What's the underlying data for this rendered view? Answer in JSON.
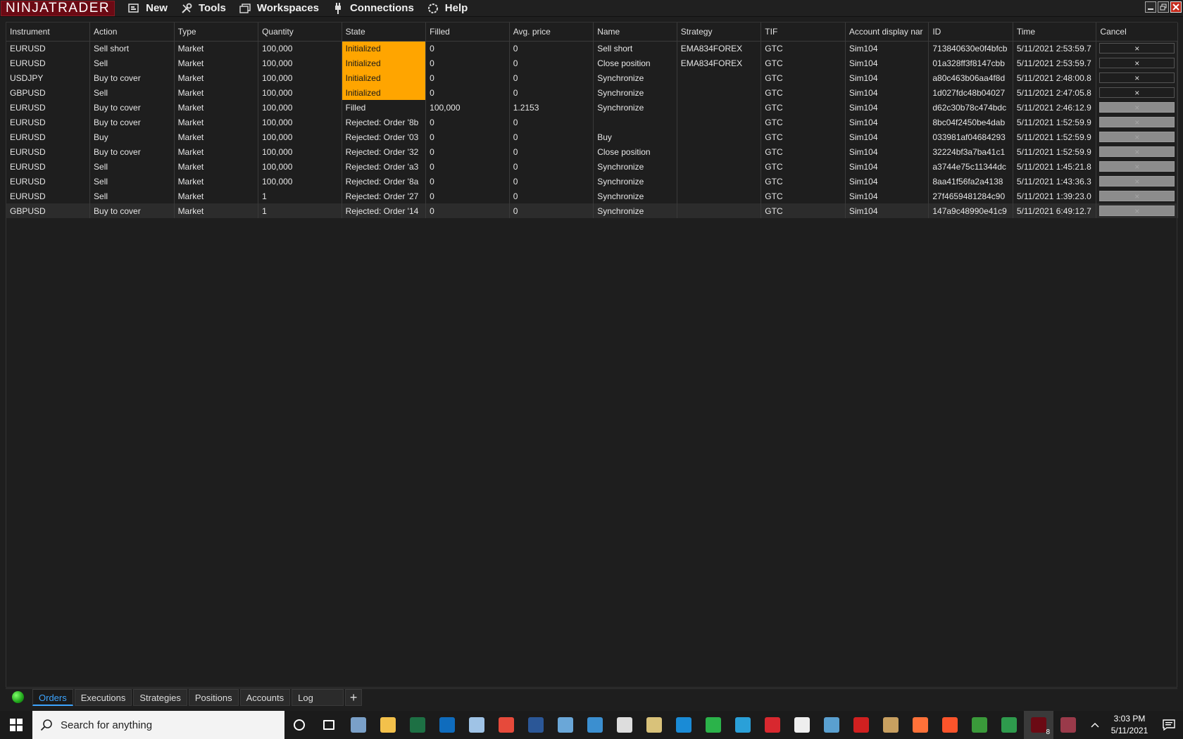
{
  "app": {
    "logo_text": "NINJATRADER",
    "menu": [
      {
        "label": "New",
        "icon": "new-window-icon"
      },
      {
        "label": "Tools",
        "icon": "tools-icon"
      },
      {
        "label": "Workspaces",
        "icon": "workspaces-icon"
      },
      {
        "label": "Connections",
        "icon": "connections-plug-icon"
      },
      {
        "label": "Help",
        "icon": "help-icon"
      }
    ]
  },
  "grid": {
    "columns": [
      "Instrument",
      "Action",
      "Type",
      "Quantity",
      "State",
      "Filled",
      "Avg. price",
      "Name",
      "Strategy",
      "TIF",
      "Account display nar",
      "ID",
      "Time",
      "Cancel"
    ],
    "rows": [
      {
        "instrument": "EURUSD",
        "action": "Sell short",
        "type": "Market",
        "quantity": "100,000",
        "state": "Initialized",
        "filled": "0",
        "avg_price": "0",
        "name": "Sell short",
        "strategy": "EMA834FOREX",
        "tif": "GTC",
        "account": "Sim104",
        "id": "713840630e0f4bfcb",
        "time": "5/11/2021 2:53:59.7",
        "cancel_enabled": true
      },
      {
        "instrument": "EURUSD",
        "action": "Sell",
        "type": "Market",
        "quantity": "100,000",
        "state": "Initialized",
        "filled": "0",
        "avg_price": "0",
        "name": "Close position",
        "strategy": "EMA834FOREX",
        "tif": "GTC",
        "account": "Sim104",
        "id": "01a328ff3f8147cbb",
        "time": "5/11/2021 2:53:59.7",
        "cancel_enabled": true
      },
      {
        "instrument": "USDJPY",
        "action": "Buy to cover",
        "type": "Market",
        "quantity": "100,000",
        "state": "Initialized",
        "filled": "0",
        "avg_price": "0",
        "name": "Synchronize",
        "strategy": "",
        "tif": "GTC",
        "account": "Sim104",
        "id": "a80c463b06aa4f8d",
        "time": "5/11/2021 2:48:00.8",
        "cancel_enabled": true
      },
      {
        "instrument": "GBPUSD",
        "action": "Sell",
        "type": "Market",
        "quantity": "100,000",
        "state": "Initialized",
        "filled": "0",
        "avg_price": "0",
        "name": "Synchronize",
        "strategy": "",
        "tif": "GTC",
        "account": "Sim104",
        "id": "1d027fdc48b04027",
        "time": "5/11/2021 2:47:05.8",
        "cancel_enabled": true
      },
      {
        "instrument": "EURUSD",
        "action": "Buy to cover",
        "type": "Market",
        "quantity": "100,000",
        "state": "Filled",
        "filled": "100,000",
        "avg_price": "1.2153",
        "name": "Synchronize",
        "strategy": "",
        "tif": "GTC",
        "account": "Sim104",
        "id": "d62c30b78c474bdc",
        "time": "5/11/2021 2:46:12.9",
        "cancel_enabled": false
      },
      {
        "instrument": "EURUSD",
        "action": "Buy to cover",
        "type": "Market",
        "quantity": "100,000",
        "state": "Rejected: Order '8b",
        "filled": "0",
        "avg_price": "0",
        "name": "",
        "strategy": "",
        "tif": "GTC",
        "account": "Sim104",
        "id": "8bc04f2450be4dab",
        "time": "5/11/2021 1:52:59.9",
        "cancel_enabled": false
      },
      {
        "instrument": "EURUSD",
        "action": "Buy",
        "type": "Market",
        "quantity": "100,000",
        "state": "Rejected: Order '03",
        "filled": "0",
        "avg_price": "0",
        "name": "Buy",
        "strategy": "",
        "tif": "GTC",
        "account": "Sim104",
        "id": "033981af04684293",
        "time": "5/11/2021 1:52:59.9",
        "cancel_enabled": false
      },
      {
        "instrument": "EURUSD",
        "action": "Buy to cover",
        "type": "Market",
        "quantity": "100,000",
        "state": "Rejected: Order '32",
        "filled": "0",
        "avg_price": "0",
        "name": "Close position",
        "strategy": "",
        "tif": "GTC",
        "account": "Sim104",
        "id": "32224bf3a7ba41c1",
        "time": "5/11/2021 1:52:59.9",
        "cancel_enabled": false
      },
      {
        "instrument": "EURUSD",
        "action": "Sell",
        "type": "Market",
        "quantity": "100,000",
        "state": "Rejected: Order 'a3",
        "filled": "0",
        "avg_price": "0",
        "name": "Synchronize",
        "strategy": "",
        "tif": "GTC",
        "account": "Sim104",
        "id": "a3744e75c11344dc",
        "time": "5/11/2021 1:45:21.8",
        "cancel_enabled": false
      },
      {
        "instrument": "EURUSD",
        "action": "Sell",
        "type": "Market",
        "quantity": "100,000",
        "state": "Rejected: Order '8a",
        "filled": "0",
        "avg_price": "0",
        "name": "Synchronize",
        "strategy": "",
        "tif": "GTC",
        "account": "Sim104",
        "id": "8aa41f56fa2a4138",
        "time": "5/11/2021 1:43:36.3",
        "cancel_enabled": false
      },
      {
        "instrument": "EURUSD",
        "action": "Sell",
        "type": "Market",
        "quantity": "1",
        "state": "Rejected: Order '27",
        "filled": "0",
        "avg_price": "0",
        "name": "Synchronize",
        "strategy": "",
        "tif": "GTC",
        "account": "Sim104",
        "id": "27f4659481284c90",
        "time": "5/11/2021 1:39:23.0",
        "cancel_enabled": false
      },
      {
        "instrument": "GBPUSD",
        "action": "Buy to cover",
        "type": "Market",
        "quantity": "1",
        "state": "Rejected: Order '14",
        "filled": "0",
        "avg_price": "0",
        "name": "Synchronize",
        "strategy": "",
        "tif": "GTC",
        "account": "Sim104",
        "id": "147a9c48990e41c9",
        "time": "5/11/2021 6:49:12.7",
        "cancel_enabled": false
      }
    ],
    "cancel_glyph": "×"
  },
  "tabs": [
    {
      "label": "Orders",
      "active": true
    },
    {
      "label": "Executions"
    },
    {
      "label": "Strategies"
    },
    {
      "label": "Positions"
    },
    {
      "label": "Accounts"
    },
    {
      "label": "Log"
    }
  ],
  "add_tab_label": "+",
  "taskbar": {
    "search_placeholder": "Search for anything",
    "time": "3:03 PM",
    "date": "5/11/2021",
    "badge_count": "8",
    "icons": [
      {
        "name": "cortana-icon",
        "color": "#1b1b1b"
      },
      {
        "name": "task-view-icon",
        "color": "#1b1b1b"
      },
      {
        "name": "photos-app-icon",
        "color": "#7aa0c8"
      },
      {
        "name": "file-explorer-icon",
        "color": "#f3c14b"
      },
      {
        "name": "excel-icon",
        "color": "#1d7044"
      },
      {
        "name": "outlook-icon",
        "color": "#0f6cbd"
      },
      {
        "name": "notes-app-icon",
        "color": "#9fc3e6"
      },
      {
        "name": "chrome-remote-icon",
        "color": "#e64a3b"
      },
      {
        "name": "word-icon",
        "color": "#2b5797"
      },
      {
        "name": "paint-icon",
        "color": "#6aa7d8"
      },
      {
        "name": "control-panel-icon",
        "color": "#3b8fd0"
      },
      {
        "name": "calculator-icon",
        "color": "#dddddd"
      },
      {
        "name": "scanner-app-icon",
        "color": "#d9c27a"
      },
      {
        "name": "store-icon",
        "color": "#1a8bd6"
      },
      {
        "name": "trading-app-icon",
        "color": "#2bb34a"
      },
      {
        "name": "edge-icon",
        "color": "#2aa0d8"
      },
      {
        "name": "security-shield-icon",
        "color": "#d8282f"
      },
      {
        "name": "tradingview-icon",
        "color": "#eeeeee"
      },
      {
        "name": "network-app-icon",
        "color": "#5aa0d0"
      },
      {
        "name": "triangle-app-icon",
        "color": "#d02020"
      },
      {
        "name": "folder-app-icon",
        "color": "#c8a060"
      },
      {
        "name": "firefox-icon",
        "color": "#ff7139"
      },
      {
        "name": "brave-icon",
        "color": "#fb542b"
      },
      {
        "name": "colorful-app-icon",
        "color": "#3a9a3a"
      },
      {
        "name": "chrome-icon",
        "color": "#2e9b4d"
      },
      {
        "name": "ninjatrader-icon",
        "color": "#6b0a14"
      },
      {
        "name": "remote-desktop-icon",
        "color": "#9a3a4a"
      }
    ]
  }
}
